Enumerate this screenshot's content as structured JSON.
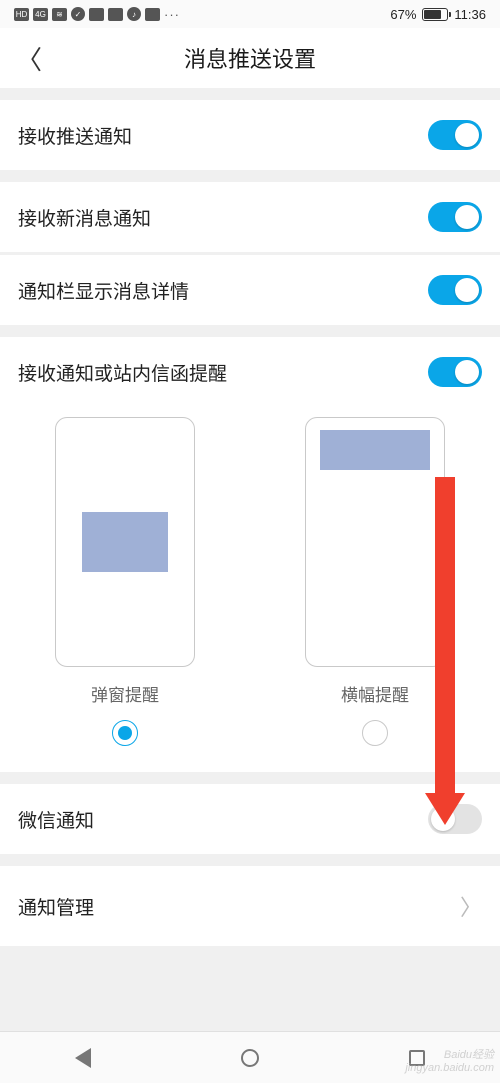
{
  "status": {
    "battery_pct": "67%",
    "time": "11:36"
  },
  "header": {
    "title": "消息推送设置"
  },
  "rows": {
    "push": {
      "label": "接收推送通知",
      "on": true
    },
    "newmsg": {
      "label": "接收新消息通知",
      "on": true
    },
    "detail": {
      "label": "通知栏显示消息详情",
      "on": true
    },
    "inbox": {
      "label": "接收通知或站内信函提醒",
      "on": true
    },
    "wechat": {
      "label": "微信通知",
      "on": false
    },
    "manage": {
      "label": "通知管理"
    }
  },
  "options": {
    "popup": {
      "label": "弹窗提醒",
      "selected": true
    },
    "banner": {
      "label": "横幅提醒",
      "selected": false
    }
  },
  "watermark": {
    "line1": "Baidu经验",
    "line2": "jingyan.baidu.com"
  }
}
